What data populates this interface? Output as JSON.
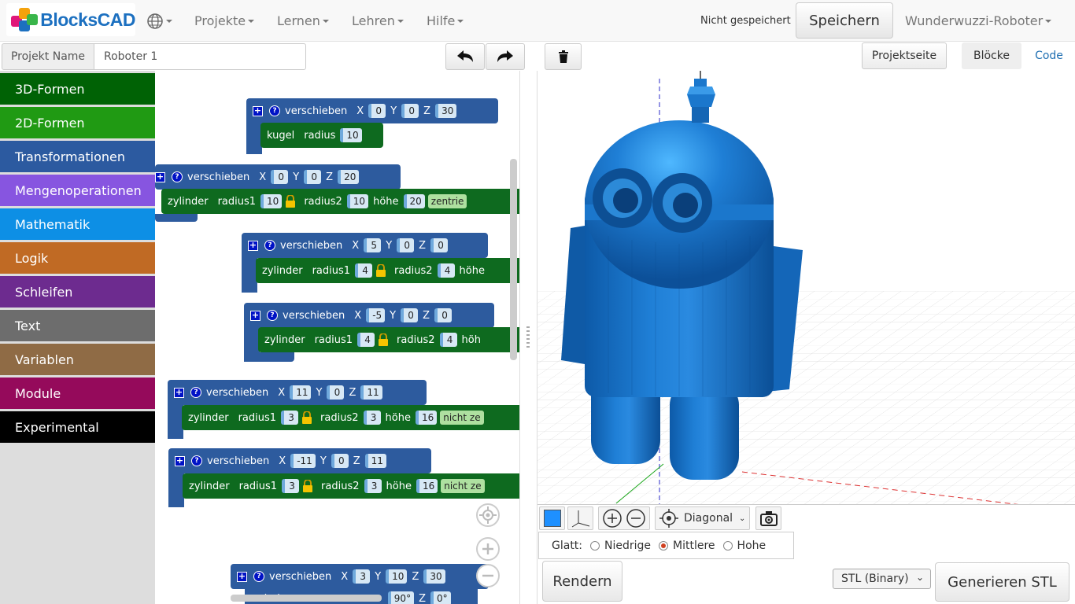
{
  "app": {
    "name": "BlocksCAD"
  },
  "nav": {
    "projects": "Projekte",
    "learn": "Lernen",
    "teach": "Lehren",
    "help": "Hilfe"
  },
  "status": {
    "save_state": "Nicht gespeichert",
    "save_label": "Speichern",
    "project_menu": "Wunderwuzzi-Roboter"
  },
  "project": {
    "name_label": "Projekt Name",
    "name_value": "Roboter 1",
    "projectpage_label": "Projektseite",
    "tab_blocks": "Blöcke",
    "tab_code": "Code"
  },
  "categories": [
    {
      "label": "3D-Formen",
      "color": "#006205"
    },
    {
      "label": "2D-Formen",
      "color": "#209a13"
    },
    {
      "label": "Transformationen",
      "color": "#2c5aa0"
    },
    {
      "label": "Mengenoperationen",
      "color": "#8755e0"
    },
    {
      "label": "Mathematik",
      "color": "#0d8fe5"
    },
    {
      "label": "Logik",
      "color": "#c06a24"
    },
    {
      "label": "Schleifen",
      "color": "#6d2b8f"
    },
    {
      "label": "Text",
      "color": "#6d6d6d"
    },
    {
      "label": "Variablen",
      "color": "#8f6b45"
    },
    {
      "label": "Module",
      "color": "#950a5b"
    },
    {
      "label": "Experimental",
      "color": "#000000"
    }
  ],
  "blocks": {
    "kw_move": "verschieben",
    "kw_x": "X",
    "kw_y": "Y",
    "kw_z": "Z",
    "kw_sphere": "kugel",
    "kw_cyl": "zylinder",
    "kw_radius": "radius",
    "kw_r1": "radius1",
    "kw_r2": "radius2",
    "kw_height": "höhe",
    "kw_centered": "zentrie",
    "kw_notcentered": "nicht ze",
    "kw_rotate": "drehen",
    "b1": {
      "x": "0",
      "y": "0",
      "z": "30",
      "r": "10"
    },
    "b2": {
      "x": "0",
      "y": "0",
      "z": "20",
      "r1": "10",
      "r2": "10",
      "h": "20"
    },
    "b3": {
      "x": "5",
      "y": "0",
      "z": "0",
      "r1": "4",
      "r2": "4",
      "h": "höhe"
    },
    "b4": {
      "x": "-5",
      "y": "0",
      "z": "0",
      "r1": "4",
      "r2": "4",
      "h": "höh"
    },
    "b5": {
      "x": "11",
      "y": "0",
      "z": "11",
      "r1": "3",
      "r2": "3",
      "h": "16"
    },
    "b6": {
      "x": "-11",
      "y": "0",
      "z": "11",
      "r1": "3",
      "r2": "3",
      "h": "16"
    },
    "b7": {
      "x": "3",
      "y": "10",
      "z": "30",
      "rx": "90°",
      "rz": "0°"
    }
  },
  "viewer": {
    "view_mode": "Diagonal",
    "smooth_label": "Glatt:",
    "smooth_low": "Niedrige",
    "smooth_mid": "Mittlere",
    "smooth_high": "Hohe",
    "smooth_selected": "Mittlere",
    "render_label": "Rendern",
    "format_value": "STL (Binary)",
    "generate_label": "Generieren STL",
    "model_color": "#1a73c9"
  }
}
